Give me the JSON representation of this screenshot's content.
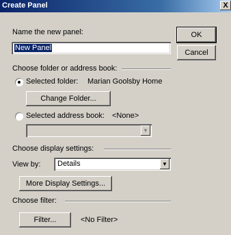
{
  "window": {
    "title": "Create Panel",
    "close_glyph": "X"
  },
  "name_section": {
    "label": "Name the new panel:",
    "value": "New Panel"
  },
  "buttons": {
    "ok": "OK",
    "cancel": "Cancel"
  },
  "folder_section": {
    "header": "Choose folder or address book:",
    "selected_folder_label": "Selected folder:",
    "selected_folder_value": "Marian Goolsby Home",
    "selected_folder_checked": true,
    "change_folder_button": "Change Folder...",
    "selected_address_book_label": "Selected address book:",
    "selected_address_book_value": "<None>",
    "selected_address_book_checked": false,
    "address_book_combo_value": ""
  },
  "display_section": {
    "header": "Choose display settings:",
    "view_by_label": "View by:",
    "view_by_value": "Details",
    "more_settings_button": "More Display Settings..."
  },
  "filter_section": {
    "header": "Choose filter:",
    "filter_button": "Filter...",
    "filter_value": "<No Filter>"
  },
  "icons": {
    "dropdown": "chevron-down-icon",
    "close": "close-icon"
  }
}
